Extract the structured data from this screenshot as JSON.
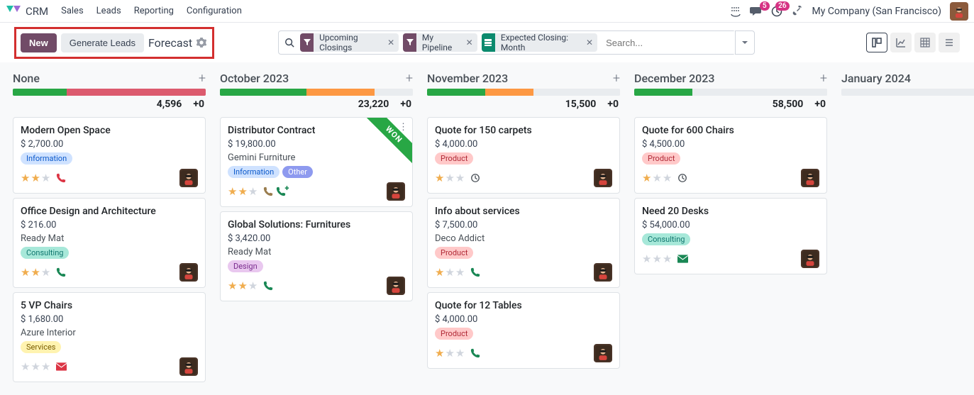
{
  "topbar": {
    "app": "CRM",
    "menus": [
      "Sales",
      "Leads",
      "Reporting",
      "Configuration"
    ],
    "msgBadge": "5",
    "activityBadge": "26",
    "company": "My Company (San Francisco)"
  },
  "controls": {
    "newLabel": "New",
    "genLabel": "Generate Leads",
    "breadcrumb": "Forecast",
    "searchPlaceholder": "Search...",
    "facets": [
      {
        "type": "filter",
        "label": "Upcoming Closings"
      },
      {
        "type": "filter",
        "label": "My Pipeline"
      },
      {
        "type": "group",
        "label": "Expected Closing: Month"
      }
    ]
  },
  "tagColors": {
    "Information": {
      "bg": "#cfe2ff",
      "fg": "#0a58ca"
    },
    "Consulting": {
      "bg": "#a7e8d9",
      "fg": "#0f766e"
    },
    "Services": {
      "bg": "#fff3b0",
      "fg": "#7a5d00"
    },
    "Other": {
      "bg": "#8e9aef",
      "fg": "#ffffff"
    },
    "Design": {
      "bg": "#e9c8ef",
      "fg": "#7b2d8e"
    },
    "Product": {
      "bg": "#ffc9c9",
      "fg": "#b02a37"
    }
  },
  "columns": [
    {
      "title": "None",
      "amount": "4,596",
      "delta": "+0",
      "progress": [
        {
          "color": "#28a745",
          "pct": 28
        },
        {
          "color": "#dc5b6e",
          "pct": 72
        }
      ],
      "cards": [
        {
          "title": "Modern Open Space",
          "amount": "$ 2,700.00",
          "sub": "",
          "tags": [
            "Information"
          ],
          "stars": 2,
          "starsTotal": 3,
          "activity": "phone-red"
        },
        {
          "title": "Office Design and Architecture",
          "amount": "$ 216.00",
          "sub": "Ready Mat",
          "tags": [
            "Consulting"
          ],
          "stars": 2,
          "starsTotal": 3,
          "activity": "phone-green"
        },
        {
          "title": "5 VP Chairs",
          "amount": "$ 1,680.00",
          "sub": "Azure Interior",
          "tags": [
            "Services"
          ],
          "stars": 0,
          "starsTotal": 3,
          "activity": "mail-red"
        }
      ]
    },
    {
      "title": "October 2023",
      "amount": "23,220",
      "delta": "+0",
      "progress": [
        {
          "color": "#28a745",
          "pct": 45
        },
        {
          "color": "#fd9843",
          "pct": 35
        },
        {
          "color": "#e9ecef",
          "pct": 20
        }
      ],
      "cards": [
        {
          "title": "Distributor Contract",
          "amount": "$ 19,800.00",
          "sub": "Gemini Furniture",
          "tags": [
            "Information",
            "Other"
          ],
          "stars": 2,
          "starsTotal": 3,
          "activity": "phone-double",
          "won": true,
          "kebab": true
        },
        {
          "title": "Global Solutions: Furnitures",
          "amount": "$ 3,420.00",
          "sub": "Ready Mat",
          "tags": [
            "Design"
          ],
          "stars": 2,
          "starsTotal": 3,
          "activity": "phone-green"
        }
      ]
    },
    {
      "title": "November 2023",
      "amount": "15,500",
      "delta": "+0",
      "progress": [
        {
          "color": "#28a745",
          "pct": 30
        },
        {
          "color": "#fd9843",
          "pct": 25
        },
        {
          "color": "#e9ecef",
          "pct": 45
        }
      ],
      "cards": [
        {
          "title": "Quote for 150 carpets",
          "amount": "$ 4,000.00",
          "sub": "",
          "tags": [
            "Product"
          ],
          "stars": 1,
          "starsTotal": 3,
          "activity": "clock"
        },
        {
          "title": "Info about services",
          "amount": "$ 7,500.00",
          "sub": "Deco Addict",
          "tags": [
            "Product"
          ],
          "stars": 1,
          "starsTotal": 3,
          "activity": "phone-green"
        },
        {
          "title": "Quote for 12 Tables",
          "amount": "$ 4,000.00",
          "sub": "",
          "tags": [
            "Product"
          ],
          "stars": 1,
          "starsTotal": 3,
          "activity": "phone-green"
        }
      ]
    },
    {
      "title": "December 2023",
      "amount": "58,500",
      "delta": "+0",
      "progress": [
        {
          "color": "#28a745",
          "pct": 30
        },
        {
          "color": "#e9ecef",
          "pct": 70
        }
      ],
      "cards": [
        {
          "title": "Quote for 600 Chairs",
          "amount": "$ 4,500.00",
          "sub": "",
          "tags": [
            "Product"
          ],
          "stars": 1,
          "starsTotal": 3,
          "activity": "clock"
        },
        {
          "title": "Need 20 Desks",
          "amount": "$ 54,000.00",
          "sub": "",
          "tags": [
            "Consulting"
          ],
          "stars": 0,
          "starsTotal": 3,
          "activity": "mail-green"
        }
      ]
    },
    {
      "title": "January 2024",
      "amount": "",
      "delta": "",
      "progress": [
        {
          "color": "#e9ecef",
          "pct": 100
        }
      ],
      "cards": []
    }
  ],
  "ribbon": {
    "won": "WON"
  }
}
